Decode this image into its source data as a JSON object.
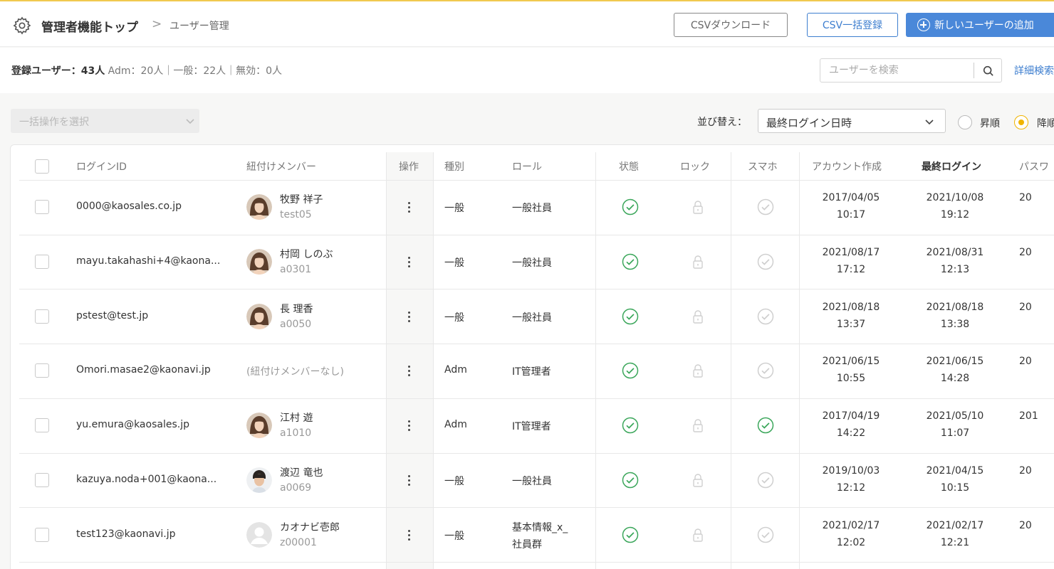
{
  "header": {
    "breadcrumb_main": "管理者機能トップ",
    "breadcrumb_sep": ">",
    "breadcrumb_sub": "ユーザー管理",
    "csv_download_label": "CSVダウンロード",
    "csv_bulk_label": "CSV一括登録",
    "add_user_label": "新しいユーザーの追加"
  },
  "stats": {
    "registered_label": "登録ユーザー：43人",
    "breakdown": "Adm：20人｜一般：22人｜無効：0人"
  },
  "search": {
    "placeholder": "ユーザーを検索",
    "advanced_label": "詳細検索"
  },
  "toolbar": {
    "bulk_placeholder": "一括操作を選択",
    "sort_label": "並び替え：",
    "sort_value": "最終ログイン日時",
    "asc_label": "昇順",
    "desc_label": "降順",
    "sort_order": "desc"
  },
  "table": {
    "columns": [
      "ログインID",
      "紐付けメンバー",
      "操作",
      "種別",
      "ロール",
      "状態",
      "ロック",
      "スマホ",
      "アカウント作成",
      "最終ログイン",
      "パスワ"
    ],
    "rows": [
      {
        "login_id": "0000@kaosales.co.jp",
        "member_name": "牧野 祥子",
        "member_code": "test05",
        "avatar": "female",
        "type": "一般",
        "role_1": "一般社員",
        "role_2": "",
        "smartphone_enabled": false,
        "created_date": "2017/04/05",
        "created_time": "10:17",
        "last_login_date": "2021/10/08",
        "last_login_time": "19:12",
        "password_partial": "20"
      },
      {
        "login_id": "mayu.takahashi+4@kaona...",
        "member_name": "村岡 しのぶ",
        "member_code": "a0301",
        "avatar": "female",
        "type": "一般",
        "role_1": "一般社員",
        "role_2": "",
        "smartphone_enabled": false,
        "created_date": "2021/08/17",
        "created_time": "17:12",
        "last_login_date": "2021/08/31",
        "last_login_time": "12:13",
        "password_partial": "20"
      },
      {
        "login_id": "pstest@test.jp",
        "member_name": "長 理香",
        "member_code": "a0050",
        "avatar": "female",
        "type": "一般",
        "role_1": "一般社員",
        "role_2": "",
        "smartphone_enabled": false,
        "created_date": "2021/08/18",
        "created_time": "13:37",
        "last_login_date": "2021/08/18",
        "last_login_time": "13:38",
        "password_partial": "20"
      },
      {
        "login_id": "Omori.masae2@kaonavi.jp",
        "member_name": "(紐付けメンバーなし)",
        "member_code": "",
        "avatar": "none",
        "type": "Adm",
        "role_1": "IT管理者",
        "role_2": "",
        "smartphone_enabled": false,
        "created_date": "2021/06/15",
        "created_time": "10:55",
        "last_login_date": "2021/06/15",
        "last_login_time": "14:28",
        "password_partial": "20"
      },
      {
        "login_id": "yu.emura@kaosales.jp",
        "member_name": "江村 遊",
        "member_code": "a1010",
        "avatar": "female",
        "type": "Adm",
        "role_1": "IT管理者",
        "role_2": "",
        "smartphone_enabled": true,
        "created_date": "2017/04/19",
        "created_time": "14:22",
        "last_login_date": "2021/05/10",
        "last_login_time": "11:07",
        "password_partial": "201"
      },
      {
        "login_id": "kazuya.noda+001@kaona...",
        "member_name": "渡辺 竜也",
        "member_code": "a0069",
        "avatar": "male",
        "type": "一般",
        "role_1": "一般社員",
        "role_2": "",
        "smartphone_enabled": false,
        "created_date": "2019/10/03",
        "created_time": "12:12",
        "last_login_date": "2021/04/15",
        "last_login_time": "10:15",
        "password_partial": "20"
      },
      {
        "login_id": "test123@kaonavi.jp",
        "member_name": "カオナビ壱郎",
        "member_code": "z00001",
        "avatar": "placeholder",
        "type": "一般",
        "role_1": "基本情報_x_",
        "role_2": "社員群",
        "smartphone_enabled": false,
        "created_date": "2021/02/17",
        "created_time": "12:02",
        "last_login_date": "2021/02/17",
        "last_login_time": "12:21",
        "password_partial": "20"
      }
    ]
  },
  "colors": {
    "accent_blue": "#4a88d9",
    "link_blue": "#3d7ecf",
    "status_green": "#3aa65a",
    "radio_yellow": "#f0b400",
    "top_border": "#f1c94f"
  },
  "icons": {
    "settings": "gear-icon",
    "add": "plus-circle-icon",
    "search": "search-icon",
    "status": "check-circle-icon",
    "lock": "lock-icon",
    "smartphone": "check-circle-icon",
    "more": "kebab-icon"
  }
}
